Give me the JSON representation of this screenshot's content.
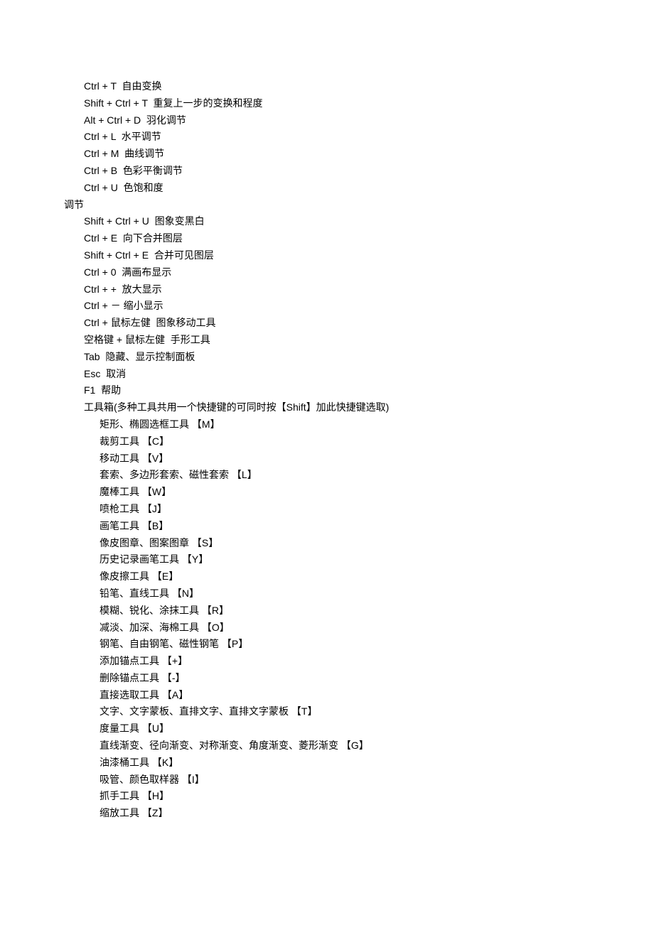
{
  "lines": [
    {
      "indent": 1,
      "text": "Ctrl + T  自由变换"
    },
    {
      "indent": 1,
      "text": "Shift + Ctrl + T  重复上一步的变换和程度"
    },
    {
      "indent": 1,
      "text": "Alt + Ctrl + D  羽化调节"
    },
    {
      "indent": 1,
      "text": "Ctrl + L  水平调节"
    },
    {
      "indent": 1,
      "text": "Ctrl + M  曲线调节"
    },
    {
      "indent": 1,
      "text": "Ctrl + B  色彩平衡调节"
    },
    {
      "indent": 1,
      "text": "Ctrl + U  色饱和度"
    },
    {
      "indent": 0,
      "text": "调节"
    },
    {
      "indent": 1,
      "text": "Shift + Ctrl + U  图象变黑白"
    },
    {
      "indent": 1,
      "text": "Ctrl + E  向下合并图层"
    },
    {
      "indent": 1,
      "text": "Shift + Ctrl + E  合并可见图层"
    },
    {
      "indent": 1,
      "text": "Ctrl + 0  满画布显示"
    },
    {
      "indent": 1,
      "text": "Ctrl + +  放大显示"
    },
    {
      "indent": 1,
      "text": "Ctrl + － 缩小显示"
    },
    {
      "indent": 1,
      "text": "Ctrl + 鼠标左健  图象移动工具"
    },
    {
      "indent": 1,
      "text": "空格键 + 鼠标左健  手形工具"
    },
    {
      "indent": 1,
      "text": "Tab  隐藏、显示控制面板"
    },
    {
      "indent": 1,
      "text": "Esc  取消"
    },
    {
      "indent": 1,
      "text": "F1  帮助"
    },
    {
      "indent": 1,
      "text": "工具箱(多种工具共用一个快捷键的可同时按【Shift】加此快捷键选取)"
    },
    {
      "indent": 2,
      "text": "矩形、椭圆选框工具 【M】"
    },
    {
      "indent": 2,
      "text": "裁剪工具 【C】"
    },
    {
      "indent": 2,
      "text": "移动工具 【V】"
    },
    {
      "indent": 2,
      "text": "套索、多边形套索、磁性套索 【L】"
    },
    {
      "indent": 2,
      "text": "魔棒工具 【W】"
    },
    {
      "indent": 2,
      "text": "喷枪工具 【J】"
    },
    {
      "indent": 2,
      "text": "画笔工具 【B】"
    },
    {
      "indent": 2,
      "text": "像皮图章、图案图章 【S】"
    },
    {
      "indent": 2,
      "text": "历史记录画笔工具 【Y】"
    },
    {
      "indent": 2,
      "text": "像皮擦工具 【E】"
    },
    {
      "indent": 2,
      "text": "铅笔、直线工具 【N】"
    },
    {
      "indent": 2,
      "text": "模糊、锐化、涂抹工具 【R】"
    },
    {
      "indent": 2,
      "text": "减淡、加深、海棉工具 【O】"
    },
    {
      "indent": 2,
      "text": "钢笔、自由钢笔、磁性钢笔 【P】"
    },
    {
      "indent": 2,
      "text": "添加锚点工具 【+】"
    },
    {
      "indent": 2,
      "text": "删除锚点工具 【-】"
    },
    {
      "indent": 2,
      "text": "直接选取工具 【A】"
    },
    {
      "indent": 2,
      "text": "文字、文字蒙板、直排文字、直排文字蒙板 【T】"
    },
    {
      "indent": 2,
      "text": "度量工具 【U】"
    },
    {
      "indent": 2,
      "text": "直线渐变、径向渐变、对称渐变、角度渐变、菱形渐变 【G】"
    },
    {
      "indent": 2,
      "text": "油漆桶工具 【K】"
    },
    {
      "indent": 2,
      "text": "吸管、颜色取样器 【I】"
    },
    {
      "indent": 2,
      "text": "抓手工具 【H】"
    },
    {
      "indent": 2,
      "text": "缩放工具 【Z】"
    }
  ]
}
